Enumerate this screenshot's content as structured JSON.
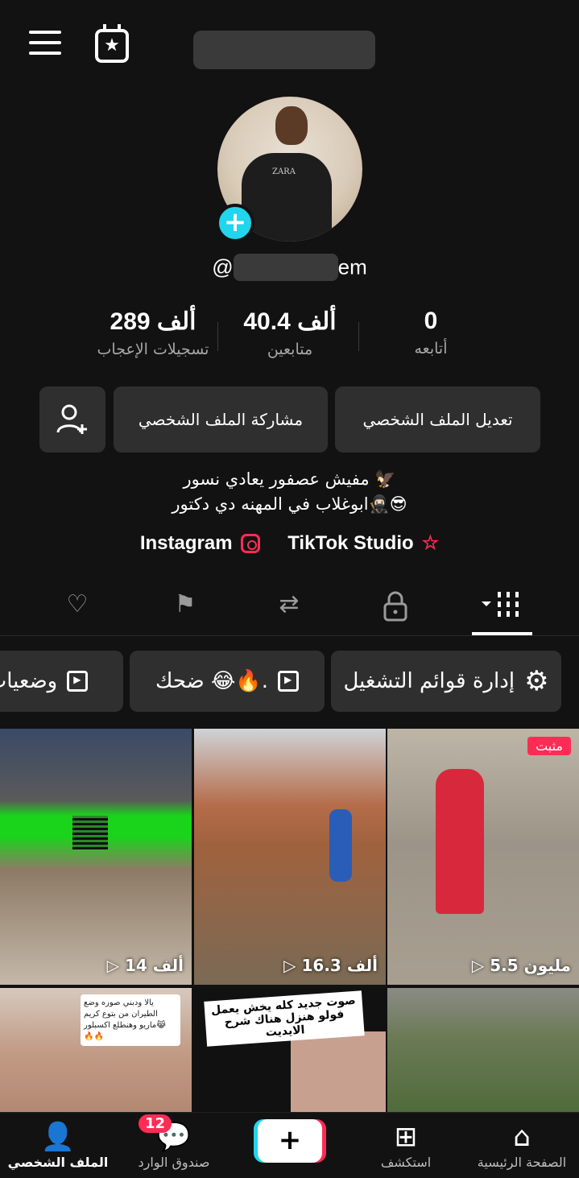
{
  "profile": {
    "username_suffix": "em",
    "at": "@",
    "avatar_shirt_text": "ZARA"
  },
  "stats": {
    "likes": {
      "value": "289 ألف",
      "label": "تسجيلات الإعجاب"
    },
    "followers": {
      "value": "40.4 ألف",
      "label": "متابعين"
    },
    "following": {
      "value": "0",
      "label": "أتابعه"
    }
  },
  "buttons": {
    "edit_profile": "تعديل الملف الشخصي",
    "share_profile": "مشاركة الملف الشخصي"
  },
  "bio": {
    "line1": "مفيش عصفور يعادي نسور 🦅",
    "line2": "ابوغلاب في المهنه دي دكتور🥷🏻😎"
  },
  "links": {
    "instagram": "Instagram",
    "studio": "TikTok Studio"
  },
  "playlists": {
    "manage": "إدارة قوائم التشغيل",
    "laugh": "ضحك 😂🔥.",
    "statuses": "وضعيات"
  },
  "videos": [
    {
      "views": "5.5 مليون",
      "pinned": "مثبت"
    },
    {
      "views": "16.3 ألف"
    },
    {
      "views": "14 ألف"
    },
    {
      "caption": ""
    },
    {
      "caption": "صوت جديد كله يخش يعمل فولو هنزل هناك شرح الايديت"
    },
    {
      "caption": "يالا ودبني صوره وضع الطيران من بتوع كريم ماريو وهنطلع اكسبلور😹 🔥🔥"
    }
  ],
  "nav": {
    "home": "الصفحة الرئيسية",
    "discover": "استكشف",
    "inbox": "صندوق الوارد",
    "inbox_badge": "12",
    "profile": "الملف الشخصي"
  }
}
